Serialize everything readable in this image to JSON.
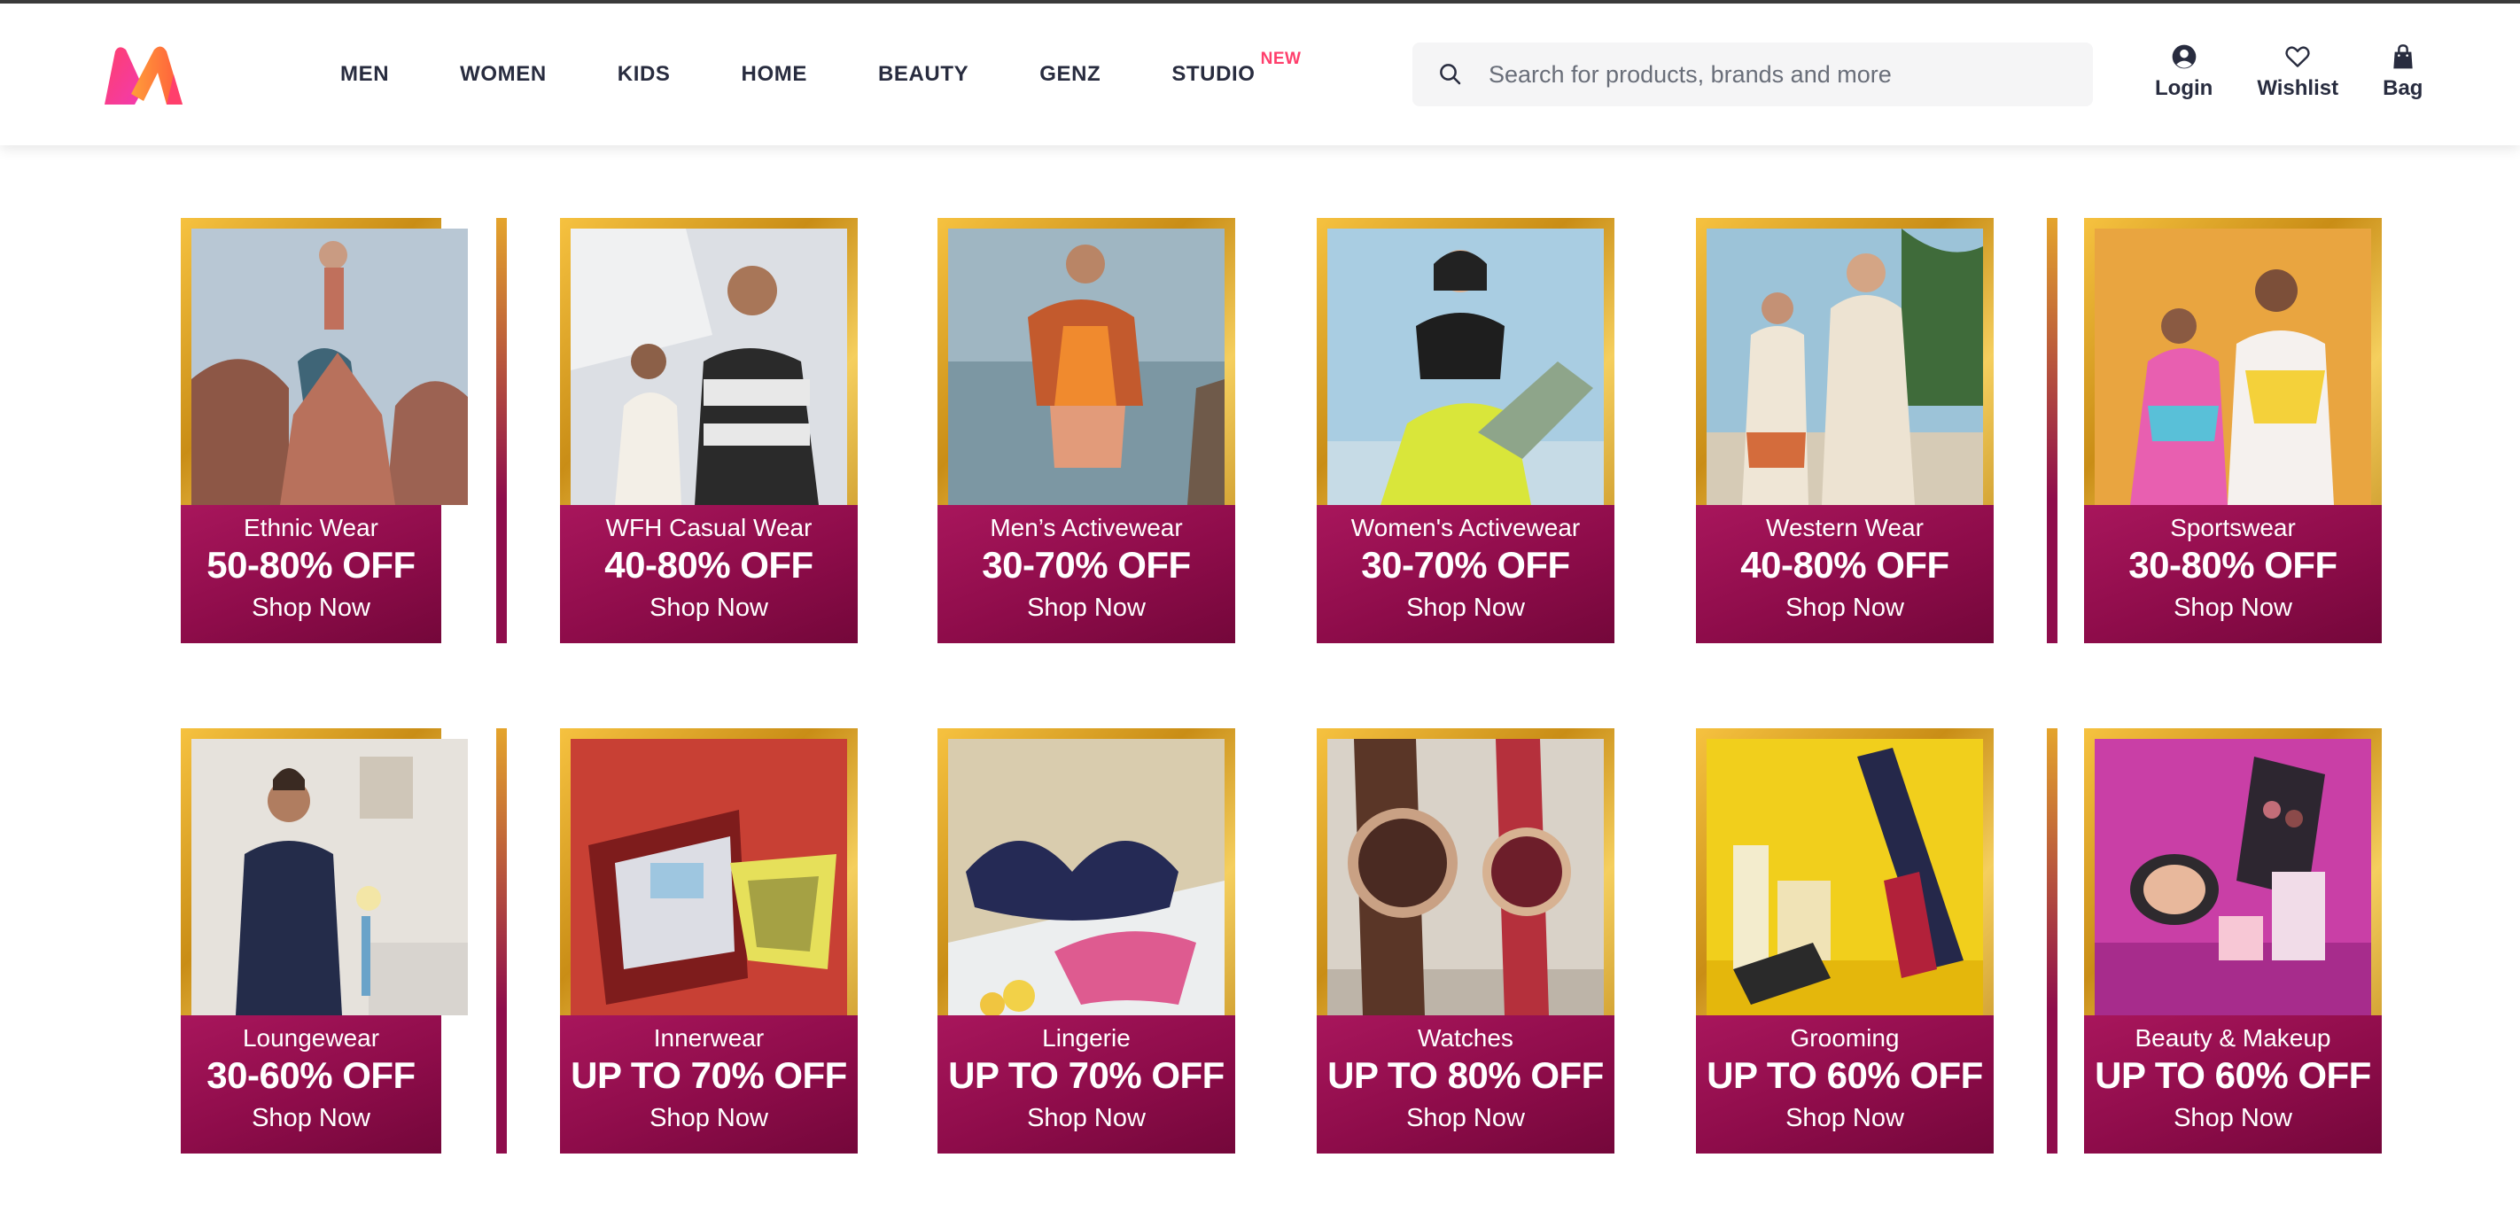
{
  "nav": {
    "items": [
      {
        "label": "MEN"
      },
      {
        "label": "WOMEN"
      },
      {
        "label": "KIDS"
      },
      {
        "label": "HOME"
      },
      {
        "label": "BEAUTY"
      },
      {
        "label": "GENZ"
      },
      {
        "label": "STUDIO",
        "badge": "NEW"
      }
    ]
  },
  "search": {
    "placeholder": "Search for products, brands and more"
  },
  "actions": {
    "login": "Login",
    "wishlist": "Wishlist",
    "bag": "Bag"
  },
  "tiles": [
    {
      "category": "Ethnic Wear",
      "offer": "50-80% OFF",
      "cta": "Shop Now"
    },
    {
      "category": "WFH Casual Wear",
      "offer": "40-80% OFF",
      "cta": "Shop Now"
    },
    {
      "category": "Men’s Activewear",
      "offer": "30-70% OFF",
      "cta": "Shop Now"
    },
    {
      "category": "Women's Activewear",
      "offer": "30-70% OFF",
      "cta": "Shop Now"
    },
    {
      "category": "Western Wear",
      "offer": "40-80% OFF",
      "cta": "Shop Now"
    },
    {
      "category": "Sportswear",
      "offer": "30-80% OFF",
      "cta": "Shop Now"
    },
    {
      "category": "Loungewear",
      "offer": "30-60% OFF",
      "cta": "Shop Now"
    },
    {
      "category": "Innerwear",
      "offer": "UP TO 70% OFF",
      "cta": "Shop Now"
    },
    {
      "category": "Lingerie",
      "offer": "UP TO 70% OFF",
      "cta": "Shop Now"
    },
    {
      "category": "Watches",
      "offer": "UP TO 80% OFF",
      "cta": "Shop Now"
    },
    {
      "category": "Grooming",
      "offer": "UP TO 60% OFF",
      "cta": "Shop Now"
    },
    {
      "category": "Beauty & Makeup",
      "offer": "UP TO 60% OFF",
      "cta": "Shop Now"
    }
  ],
  "colors": {
    "accent": "#ff3f6c",
    "band": "#8e0c4a",
    "frame": "#e0a32a",
    "text": "#282c3f"
  }
}
